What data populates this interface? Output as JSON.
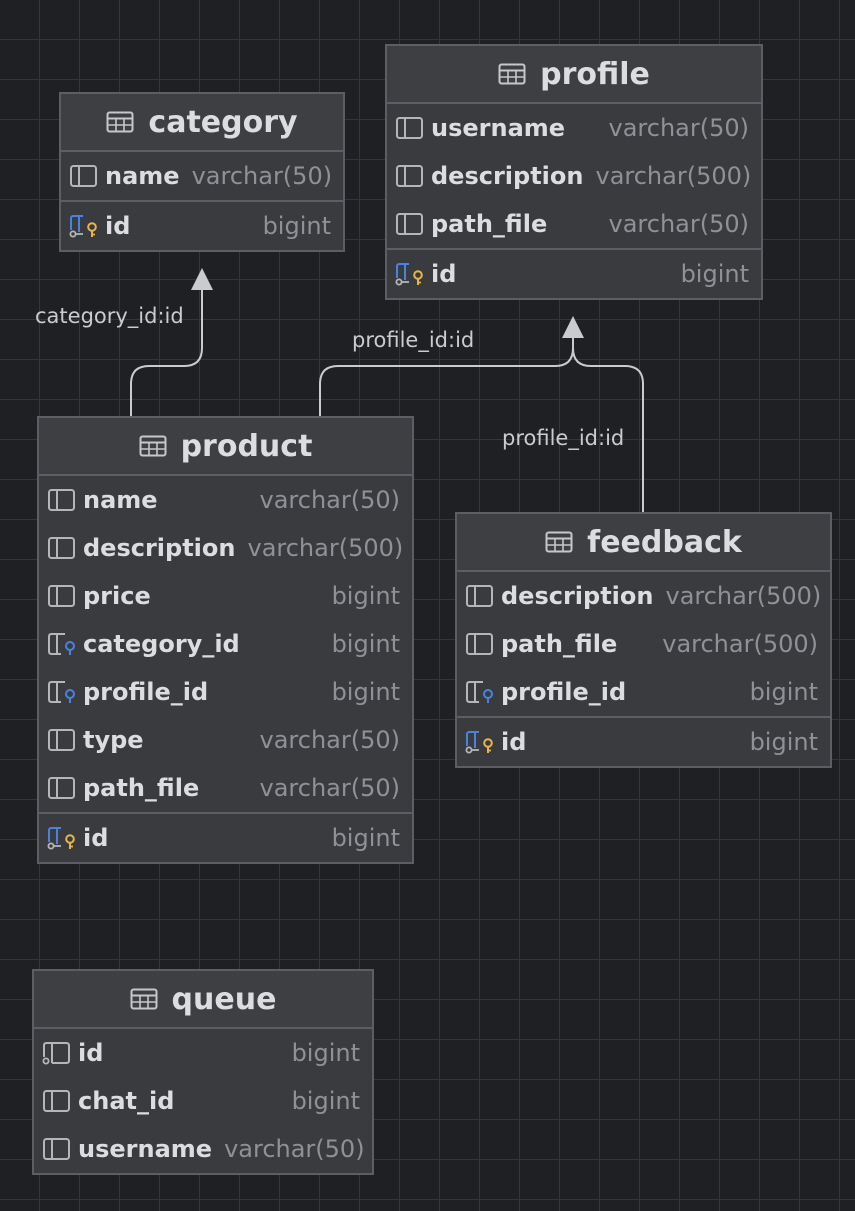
{
  "tables": {
    "category": {
      "title": "category",
      "columns": [
        {
          "name": "name",
          "type": "varchar(50)",
          "icon": "column-icon"
        },
        {
          "name": "id",
          "type": "bigint",
          "icon": "primary-key-icon",
          "pk": true
        }
      ]
    },
    "profile": {
      "title": "profile",
      "columns": [
        {
          "name": "username",
          "type": "varchar(50)",
          "icon": "column-icon"
        },
        {
          "name": "description",
          "type": "varchar(500)",
          "icon": "column-icon"
        },
        {
          "name": "path_file",
          "type": "varchar(50)",
          "icon": "column-icon"
        },
        {
          "name": "id",
          "type": "bigint",
          "icon": "primary-key-icon",
          "pk": true
        }
      ]
    },
    "product": {
      "title": "product",
      "columns": [
        {
          "name": "name",
          "type": "varchar(50)",
          "icon": "column-icon"
        },
        {
          "name": "description",
          "type": "varchar(500)",
          "icon": "column-icon"
        },
        {
          "name": "price",
          "type": "bigint",
          "icon": "column-icon"
        },
        {
          "name": "category_id",
          "type": "bigint",
          "icon": "foreign-key-icon"
        },
        {
          "name": "profile_id",
          "type": "bigint",
          "icon": "foreign-key-icon"
        },
        {
          "name": "type",
          "type": "varchar(50)",
          "icon": "column-icon"
        },
        {
          "name": "path_file",
          "type": "varchar(50)",
          "icon": "column-icon"
        },
        {
          "name": "id",
          "type": "bigint",
          "icon": "primary-key-icon",
          "pk": true
        }
      ]
    },
    "feedback": {
      "title": "feedback",
      "columns": [
        {
          "name": "description",
          "type": "varchar(500)",
          "icon": "column-icon"
        },
        {
          "name": "path_file",
          "type": "varchar(500)",
          "icon": "column-icon"
        },
        {
          "name": "profile_id",
          "type": "bigint",
          "icon": "foreign-key-icon"
        },
        {
          "name": "id",
          "type": "bigint",
          "icon": "primary-key-icon",
          "pk": true
        }
      ]
    },
    "queue": {
      "title": "queue",
      "columns": [
        {
          "name": "id",
          "type": "bigint",
          "icon": "key-column-icon"
        },
        {
          "name": "chat_id",
          "type": "bigint",
          "icon": "column-icon"
        },
        {
          "name": "username",
          "type": "varchar(50)",
          "icon": "column-icon"
        }
      ]
    }
  },
  "relations": [
    {
      "from": "product",
      "to": "category",
      "label": "category_id:id"
    },
    {
      "from": "product",
      "to": "profile",
      "label": "profile_id:id"
    },
    {
      "from": "feedback",
      "to": "profile",
      "label": "profile_id:id"
    }
  ],
  "colors": {
    "background": "#1f2023",
    "grid": "#34363b",
    "table_fill": "#3a3b3e",
    "border": "#5c5e63",
    "text": "#dcdde0",
    "type_text": "#8f9196",
    "key_blue": "#4a82e0",
    "key_gold": "#e5b74a",
    "edge": "#c9cbcf"
  }
}
